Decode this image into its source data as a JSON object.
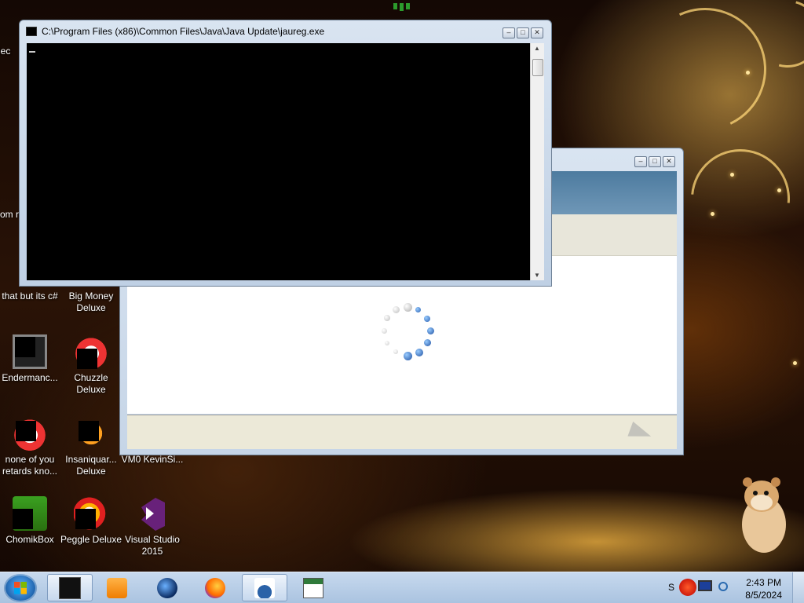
{
  "desktop_icons": [
    {
      "label": "Rec",
      "id": "recycle"
    },
    {
      "label": "that but its c#",
      "id": "that-but-its-csharp"
    },
    {
      "label": "Big Money Deluxe",
      "id": "big-money"
    },
    {
      "label": "Endermanc...",
      "id": "endermanc"
    },
    {
      "label": "Chuzzle Deluxe",
      "id": "chuzzle"
    },
    {
      "label": "none of you retards kno...",
      "id": "none-of-you"
    },
    {
      "label": "Insaniquar... Deluxe",
      "id": "insaniquarium"
    },
    {
      "label": "VM0 KevinSi...",
      "id": "vm0"
    },
    {
      "label": "ChomikBox",
      "id": "chomikbox"
    },
    {
      "label": "Peggle Deluxe",
      "id": "peggle"
    },
    {
      "label": "Visual Studio 2015",
      "id": "visual-studio"
    },
    {
      "label": "som ra",
      "id": "partial-som"
    }
  ],
  "console_window": {
    "title": "C:\\Program Files (x86)\\Common Files\\Java\\Java Update\\jaureg.exe",
    "minimize": "–",
    "maximize": "□",
    "close": "✕",
    "scroll_up": "▲",
    "scroll_down": "▼"
  },
  "updater_window": {
    "minimize": "–",
    "maximize": "□",
    "close": "✕"
  },
  "taskbar": {
    "items": [
      {
        "name": "cmd",
        "active": true
      },
      {
        "name": "media-player",
        "active": false
      },
      {
        "name": "globe",
        "active": false
      },
      {
        "name": "firefox",
        "active": false
      },
      {
        "name": "java",
        "active": true
      },
      {
        "name": "app-window",
        "active": false
      }
    ],
    "tray_text": "S",
    "time": "2:43 PM",
    "date": "8/5/2024"
  },
  "colors": {
    "console_bg": "#000000",
    "banner": "#5a87aa",
    "taskbar": "#b9cfe8"
  }
}
